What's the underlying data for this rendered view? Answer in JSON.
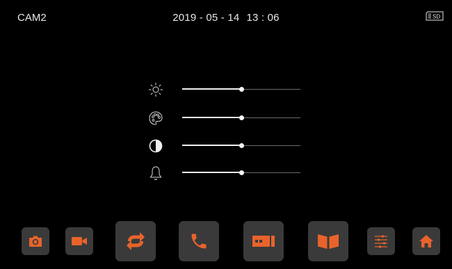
{
  "status_bar": {
    "camera": "CAM2",
    "date": "2019 - 05 - 14",
    "time": "13 : 06",
    "storage_icon": "sd-card-icon",
    "storage_label": "SD"
  },
  "adjustments": [
    {
      "name": "brightness",
      "icon": "brightness-icon",
      "level": 0.5
    },
    {
      "name": "color",
      "icon": "palette-icon",
      "level": 0.5
    },
    {
      "name": "contrast",
      "icon": "contrast-icon",
      "level": 0.5
    },
    {
      "name": "volume",
      "icon": "bell-icon",
      "level": 0.5
    }
  ],
  "dock": {
    "accent_color": "#e8632b",
    "button_bg": "#3a3a3a",
    "buttons": [
      {
        "name": "snapshot",
        "icon": "camera-icon"
      },
      {
        "name": "record",
        "icon": "video-camera-icon"
      },
      {
        "name": "switch",
        "icon": "switch-arrows-icon"
      },
      {
        "name": "talk",
        "icon": "phone-icon"
      },
      {
        "name": "unlock",
        "icon": "door-lock-icon"
      },
      {
        "name": "playback",
        "icon": "book-icon"
      },
      {
        "name": "settings",
        "icon": "sliders-icon"
      },
      {
        "name": "home",
        "icon": "home-icon"
      }
    ]
  }
}
